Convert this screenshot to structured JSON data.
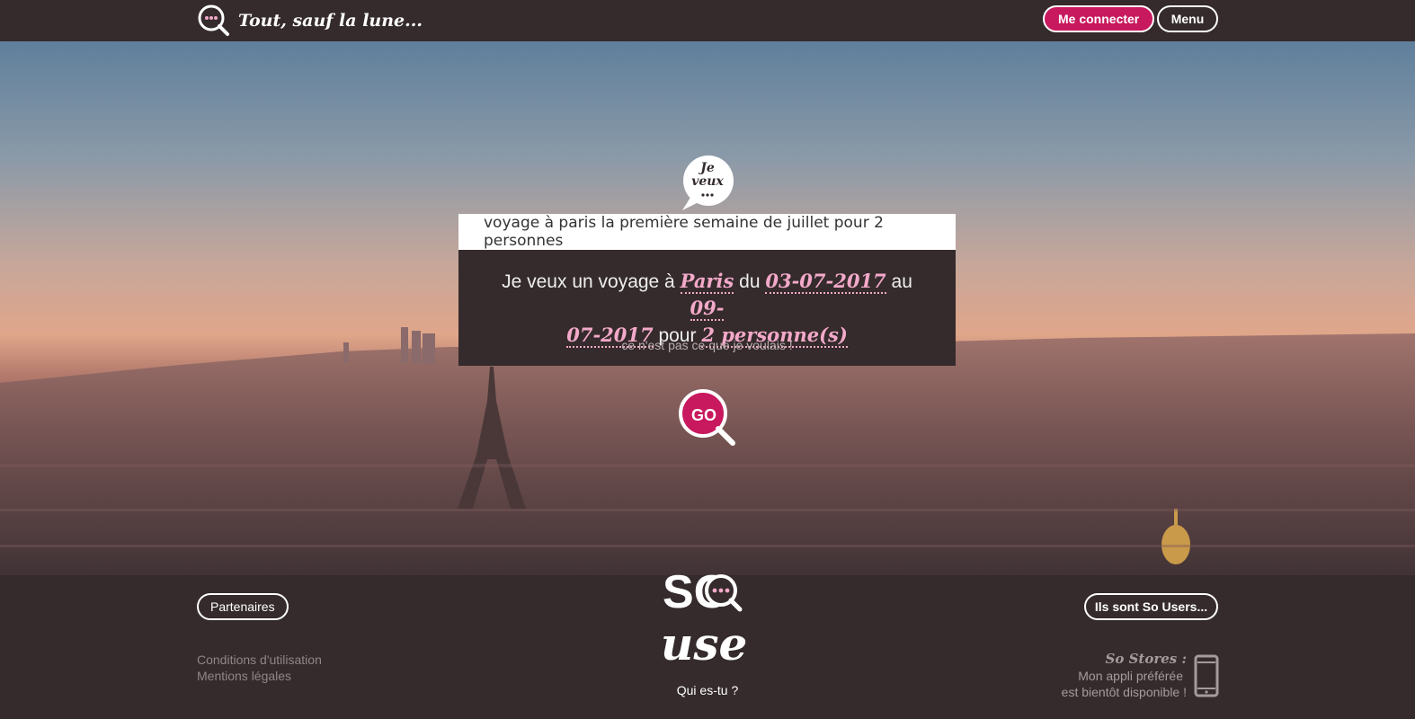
{
  "header": {
    "brand": "Tout, sauf la lune...",
    "login_label": "Me connecter",
    "menu_label": "Menu"
  },
  "hero": {
    "bubble_line1": "Je",
    "bubble_line2": "veux",
    "search_value": "voyage à paris la première semaine de juillet pour 2 personnes",
    "result": {
      "prefix": "Je veux un voyage à",
      "city": "Paris",
      "from_word": "du",
      "date_from": "03-07-2017",
      "to_word": "au",
      "date_to_a": "09-",
      "date_to_b": "07-2017",
      "for_word": "pour",
      "people": "2 personne(s)"
    },
    "not_wanted": "ce n'est pas ce que je voulais !",
    "go_label": "GO"
  },
  "footer": {
    "partners_label": "Partenaires",
    "cgu": "Conditions d'utilisation",
    "legal": "Mentions légales",
    "logo_top": "SO",
    "logo_bottom": "use",
    "who": "Qui es-tu ?",
    "users_label": "Ils sont So Users...",
    "stores_title": "So Stores :",
    "stores_line1": "Mon appli préférée",
    "stores_line2": "est bientôt disponible !"
  },
  "colors": {
    "background": "#352b2c",
    "accent": "#c8185e",
    "highlight": "#f3a9c9"
  },
  "icons": [
    "chat-magnifier-icon",
    "speech-bubble-icon",
    "go-magnifier-icon",
    "phone-icon"
  ]
}
